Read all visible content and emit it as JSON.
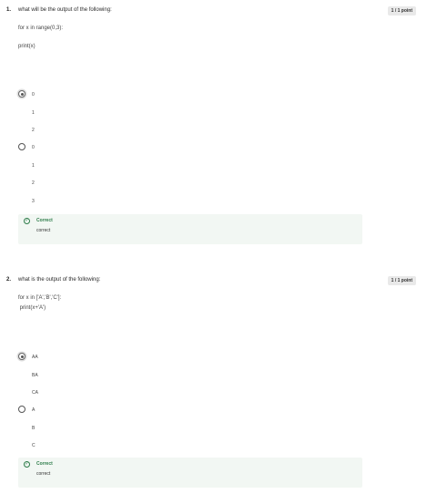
{
  "questions": [
    {
      "number": "1.",
      "text": "what will be the output of the following:",
      "points": "1 / 1 point",
      "code": [
        "for x in range(0,3):",
        "print(x)"
      ],
      "options": [
        {
          "lines": [
            "0",
            "1",
            "2"
          ],
          "selected": true
        },
        {
          "lines": [
            "0",
            "1",
            "2",
            "3"
          ],
          "selected": false
        }
      ],
      "feedback": {
        "label": "Correct",
        "message": "correct"
      }
    },
    {
      "number": "2.",
      "text": "what is the output of the following:",
      "points": "1 / 1 point",
      "code": [
        "for x in ['A','B','C']:",
        " print(x+'A')"
      ],
      "options": [
        {
          "lines": [
            "AA",
            "BA",
            "CA"
          ],
          "selected": true
        },
        {
          "lines": [
            "A",
            "B",
            "C"
          ],
          "selected": false
        }
      ],
      "feedback": {
        "label": "Correct",
        "message": "correct"
      }
    }
  ],
  "colors": {
    "correct": "#2e7d4a",
    "feedback_bg": "#f2f7f3",
    "badge_bg": "#e9e9e9"
  }
}
